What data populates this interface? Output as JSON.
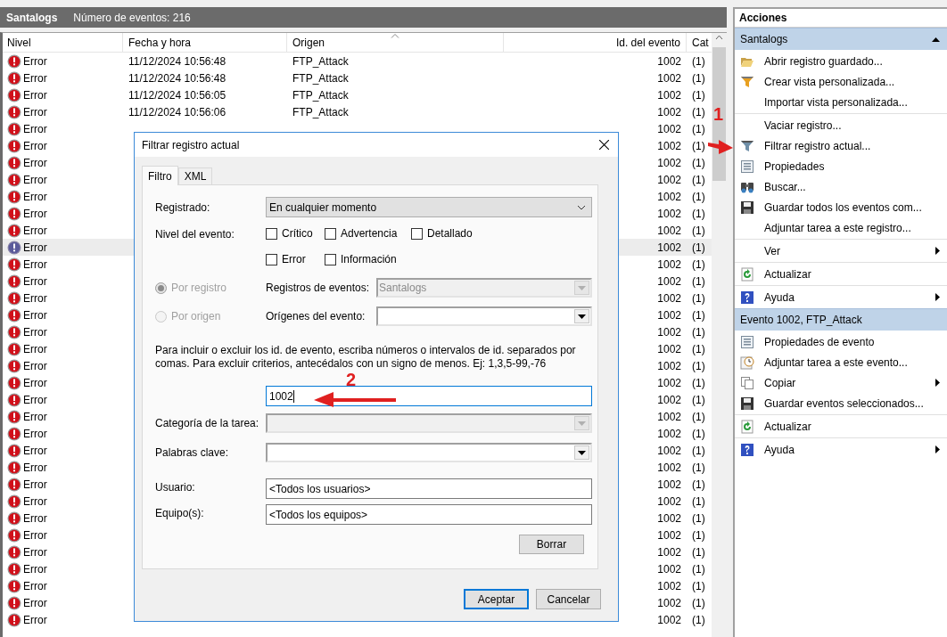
{
  "header": {
    "title": "Santalogs",
    "count": "Número de eventos: 216"
  },
  "table": {
    "columns": [
      {
        "label": "Nivel",
        "sorted": false
      },
      {
        "label": "Fecha y hora",
        "sorted": false
      },
      {
        "label": "Origen",
        "sorted": true
      },
      {
        "label": "Id. del evento",
        "sorted": false
      },
      {
        "label": "Cat",
        "sorted": false
      }
    ],
    "rows": [
      {
        "level": "Error",
        "date": "11/12/2024 10:56:48",
        "source": "FTP_Attack",
        "event_id": "1002",
        "category": "(1)",
        "selected": false
      },
      {
        "level": "Error",
        "date": "11/12/2024 10:56:48",
        "source": "FTP_Attack",
        "event_id": "1002",
        "category": "(1)",
        "selected": false
      },
      {
        "level": "Error",
        "date": "11/12/2024 10:56:05",
        "source": "FTP_Attack",
        "event_id": "1002",
        "category": "(1)",
        "selected": false
      },
      {
        "level": "Error",
        "date": "11/12/2024 10:56:06",
        "source": "FTP_Attack",
        "event_id": "1002",
        "category": "(1)",
        "selected": false
      },
      {
        "level": "Error",
        "event_id": "1002",
        "category": "(1)",
        "selected": false
      },
      {
        "level": "Error",
        "event_id": "1002",
        "category": "(1)",
        "selected": false
      },
      {
        "level": "Error",
        "event_id": "1002",
        "category": "(1)",
        "selected": false
      },
      {
        "level": "Error",
        "event_id": "1002",
        "category": "(1)",
        "selected": false
      },
      {
        "level": "Error",
        "event_id": "1002",
        "category": "(1)",
        "selected": false
      },
      {
        "level": "Error",
        "event_id": "1002",
        "category": "(1)",
        "selected": false
      },
      {
        "level": "Error",
        "event_id": "1002",
        "category": "(1)",
        "selected": false
      },
      {
        "level": "Error",
        "event_id": "1002",
        "category": "(1)",
        "selected": true
      },
      {
        "level": "Error",
        "event_id": "1002",
        "category": "(1)",
        "selected": false
      },
      {
        "level": "Error",
        "event_id": "1002",
        "category": "(1)",
        "selected": false
      },
      {
        "level": "Error",
        "event_id": "1002",
        "category": "(1)",
        "selected": false
      },
      {
        "level": "Error",
        "event_id": "1002",
        "category": "(1)",
        "selected": false
      },
      {
        "level": "Error",
        "event_id": "1002",
        "category": "(1)",
        "selected": false
      },
      {
        "level": "Error",
        "event_id": "1002",
        "category": "(1)",
        "selected": false
      },
      {
        "level": "Error",
        "event_id": "1002",
        "category": "(1)",
        "selected": false
      },
      {
        "level": "Error",
        "event_id": "1002",
        "category": "(1)",
        "selected": false
      },
      {
        "level": "Error",
        "event_id": "1002",
        "category": "(1)",
        "selected": false
      },
      {
        "level": "Error",
        "event_id": "1002",
        "category": "(1)",
        "selected": false
      },
      {
        "level": "Error",
        "event_id": "1002",
        "category": "(1)",
        "selected": false
      },
      {
        "level": "Error",
        "event_id": "1002",
        "category": "(1)",
        "selected": false
      },
      {
        "level": "Error",
        "event_id": "1002",
        "category": "(1)",
        "selected": false
      },
      {
        "level": "Error",
        "event_id": "1002",
        "category": "(1)",
        "selected": false
      },
      {
        "level": "Error",
        "event_id": "1002",
        "category": "(1)",
        "selected": false
      },
      {
        "level": "Error",
        "event_id": "1002",
        "category": "(1)",
        "selected": false
      },
      {
        "level": "Error",
        "event_id": "1002",
        "category": "(1)",
        "selected": false
      },
      {
        "level": "Error",
        "event_id": "1002",
        "category": "(1)",
        "selected": false
      },
      {
        "level": "Error",
        "event_id": "1002",
        "category": "(1)",
        "selected": false
      },
      {
        "level": "Error",
        "event_id": "1002",
        "category": "(1)",
        "selected": false
      },
      {
        "level": "Error",
        "event_id": "1002",
        "category": "(1)",
        "selected": false
      },
      {
        "level": "Error",
        "event_id": "1002",
        "category": "(1)",
        "selected": false
      }
    ]
  },
  "dialog": {
    "title": "Filtrar registro actual",
    "tabs": [
      {
        "label": "Filtro",
        "selected": true
      },
      {
        "label": "XML",
        "selected": false
      }
    ],
    "logged": {
      "label": "Registrado:",
      "value": "En cualquier momento"
    },
    "levels": {
      "label": "Nivel del evento:",
      "options": [
        {
          "label": "Crítico",
          "checked": false
        },
        {
          "label": "Advertencia",
          "checked": false
        },
        {
          "label": "Detallado",
          "checked": false
        },
        {
          "label": "Error",
          "checked": false
        },
        {
          "label": "Información",
          "checked": false
        }
      ]
    },
    "scope": [
      {
        "label": "Por registro",
        "selected": true,
        "disabled": true,
        "field_label": "Registros de eventos:",
        "value": "Santalogs",
        "field_disabled": true
      },
      {
        "label": "Por origen",
        "selected": false,
        "disabled": true,
        "field_label": "Orígenes del evento:",
        "field_disabled": false
      }
    ],
    "hint": "Para incluir o excluir los id. de evento, escriba números o intervalos de id. separados por comas. Para excluir criterios, antecédalos con un signo de menos. Ej: 1,3,5-99,-76",
    "event_ids": {
      "value": "1002",
      "focused": true
    },
    "category": {
      "label": "Categoría de la tarea:",
      "disabled": true
    },
    "keywords": {
      "label": "Palabras clave:",
      "disabled": false
    },
    "user": {
      "label": "Usuario:",
      "value": "<Todos los usuarios>"
    },
    "computer": {
      "label": "Equipo(s):",
      "value": "<Todos los equipos>"
    },
    "clear_button": "Borrar",
    "buttons": [
      {
        "label": "Aceptar",
        "default": true
      },
      {
        "label": "Cancelar",
        "default": false
      }
    ]
  },
  "actions": {
    "title": "Acciones",
    "sections": [
      {
        "title": "Santalogs",
        "toggle": true,
        "groups": [
          [
            {
              "label": "Abrir registro guardado...",
              "kind": "folder",
              "submenu": false
            },
            {
              "label": "Crear vista personalizada...",
              "kind": "filter-new",
              "submenu": false
            },
            {
              "label": "Importar vista personalizada...",
              "kind": "none",
              "submenu": false
            }
          ],
          [
            {
              "label": "Vaciar registro...",
              "kind": "none",
              "submenu": false
            },
            {
              "label": "Filtrar registro actual...",
              "kind": "filter",
              "submenu": false
            },
            {
              "label": "Propiedades",
              "kind": "properties",
              "submenu": false
            },
            {
              "label": "Buscar...",
              "kind": "binoculars",
              "submenu": false
            },
            {
              "label": "Guardar todos los eventos com...",
              "kind": "save",
              "submenu": false
            },
            {
              "label": "Adjuntar tarea a este registro...",
              "kind": "none",
              "submenu": false
            }
          ],
          [
            {
              "label": "Ver",
              "kind": "none",
              "submenu": true
            }
          ],
          [
            {
              "label": "Actualizar",
              "kind": "refresh",
              "submenu": false
            }
          ],
          [
            {
              "label": "Ayuda",
              "kind": "help",
              "submenu": true
            }
          ]
        ]
      },
      {
        "title": "Evento 1002, FTP_Attack",
        "toggle": false,
        "groups": [
          [
            {
              "label": "Propiedades de evento",
              "kind": "properties",
              "submenu": false
            },
            {
              "label": "Adjuntar tarea a este evento...",
              "kind": "task",
              "submenu": false
            },
            {
              "label": "Copiar",
              "kind": "copy",
              "submenu": true
            },
            {
              "label": "Guardar eventos seleccionados...",
              "kind": "save",
              "submenu": false
            }
          ],
          [
            {
              "label": "Actualizar",
              "kind": "refresh",
              "submenu": false
            }
          ],
          [
            {
              "label": "Ayuda",
              "kind": "help",
              "submenu": true
            }
          ]
        ]
      }
    ]
  },
  "annotations": [
    {
      "label": "1"
    },
    {
      "label": "2"
    }
  ]
}
